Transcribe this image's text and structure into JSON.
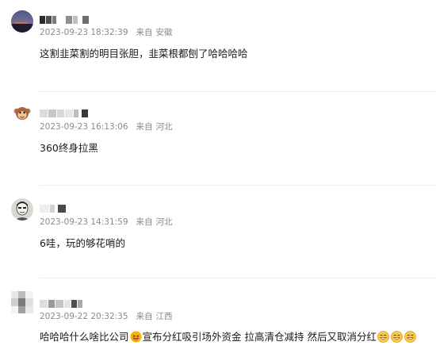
{
  "comments": [
    {
      "timestamp": "2023-09-23 18:32:39",
      "from_label": "来自",
      "location": "安徽",
      "text": "这割韭菜割的明目张胆，韭菜根都刨了哈哈哈哈",
      "avatar_icon": "night-sky-avatar-icon"
    },
    {
      "timestamp": "2023-09-23 16:13:06",
      "from_label": "来自",
      "location": "河北",
      "text": "360终身拉黑",
      "avatar_icon": "monkey-avatar-icon"
    },
    {
      "timestamp": "2023-09-23 14:31:59",
      "from_label": "来自",
      "location": "河北",
      "text": "6哇，玩的够花哨的",
      "avatar_icon": "sketch-portrait-avatar-icon"
    },
    {
      "timestamp": "2023-09-22 20:32:35",
      "from_label": "来自",
      "location": "江西",
      "text_parts": [
        "哈哈哈什么啥比公司",
        "宣布分红吸引场外资金 拉高清仓减持 然后又取消分红"
      ],
      "avatar_icon": "pixelated-avatar-icon",
      "emojis": [
        "laughing-tongue-emoji",
        "grinning-emoji"
      ]
    }
  ],
  "colors": {
    "meta_text": "#8a8a8a",
    "body_text": "#1a1a1a",
    "divider": "#ededed",
    "emoji_yellow": "#f7b500"
  }
}
